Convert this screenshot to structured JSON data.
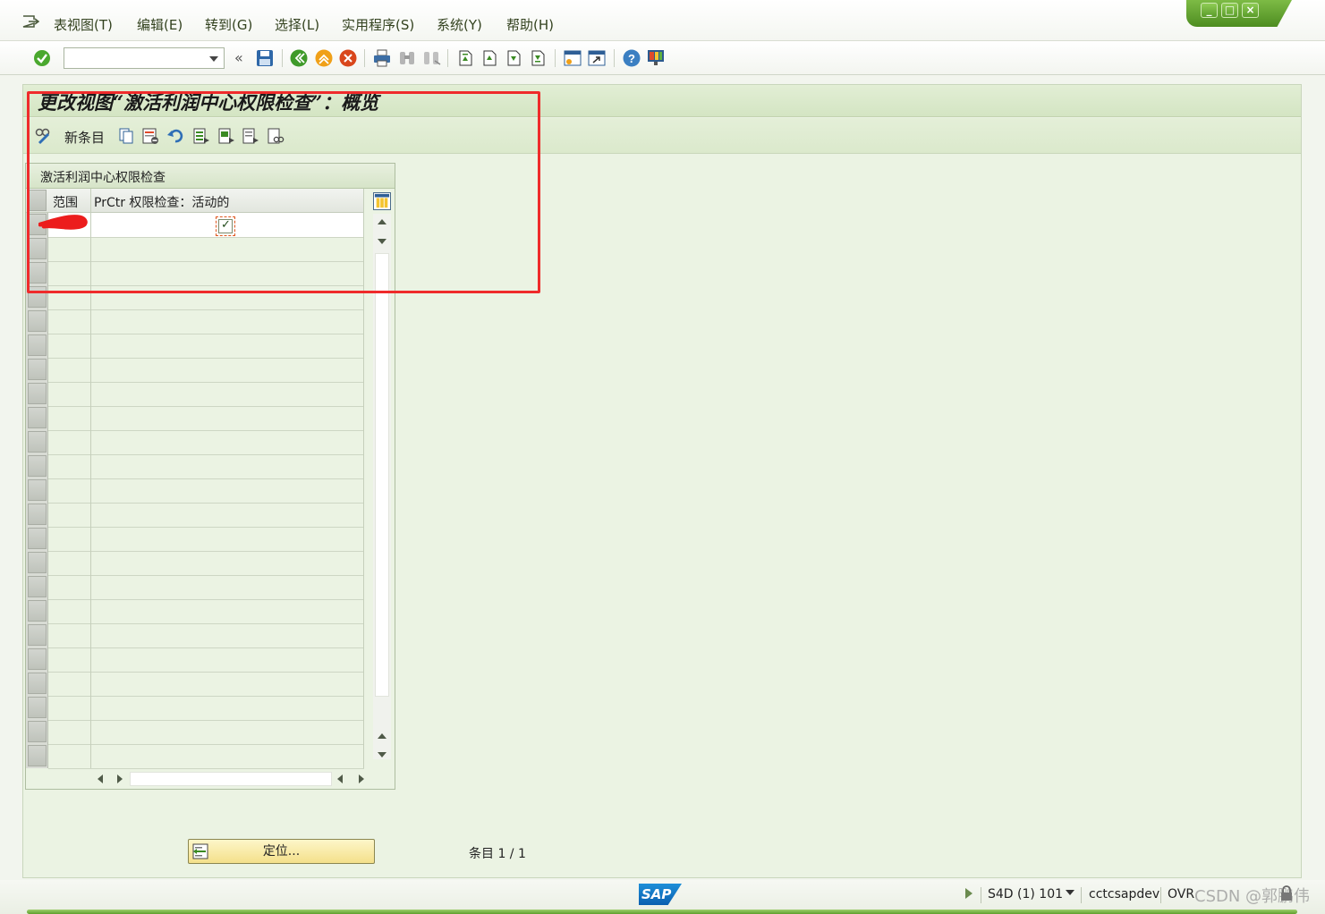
{
  "menu": {
    "items": [
      "表视图(T)",
      "编辑(E)",
      "转到(G)",
      "选择(L)",
      "实用程序(S)",
      "系统(Y)",
      "帮助(H)"
    ]
  },
  "window_controls": {
    "minimize": "_",
    "maximize": "□",
    "close": "×"
  },
  "toolbar": {
    "command_field_value": "",
    "collapse_label": "«",
    "icons": [
      "enter-check-icon",
      "save-icon",
      "back-icon",
      "exit-icon",
      "cancel-icon",
      "print-icon",
      "find-icon",
      "find-next-icon",
      "first-page-icon",
      "previous-page-icon",
      "next-page-icon",
      "last-page-icon",
      "create-session-icon",
      "shortcut-icon",
      "help-icon",
      "customize-layout-icon"
    ]
  },
  "page": {
    "title": "更改视图“激活利润中心权限检查”：概览"
  },
  "app_toolbar": {
    "new_entries_label": "新条目",
    "icons": [
      "display-change-icon",
      "copy-icon",
      "delete-icon",
      "undo-icon",
      "select-all-icon",
      "select-block-icon",
      "deselect-all-icon",
      "print-view-icon"
    ]
  },
  "table": {
    "title": "激活利润中心权限检查",
    "columns": [
      "范围",
      "PrCtr 权限检查：活动的"
    ],
    "rows": [
      {
        "scope": "",
        "active": true
      }
    ],
    "empty_rows": 22
  },
  "bottom": {
    "position_button_label": "定位...",
    "entry_label": "条目",
    "entry_current": "1",
    "entry_total": "1",
    "entry_counter": "条目 1 / 1"
  },
  "status": {
    "logo": "SAP",
    "system": "S4D (1) 101",
    "server": "cctcsapdev",
    "mode": "OVR",
    "watermark": "CSDN @郭鹏伟"
  },
  "colors": {
    "frame_bg": "#ebf3e3",
    "title_bar": "#d4e5c3",
    "annotation": "#ef2b2b",
    "button_yellow": "#f4e08a",
    "window_green": "#5a9c2a"
  }
}
